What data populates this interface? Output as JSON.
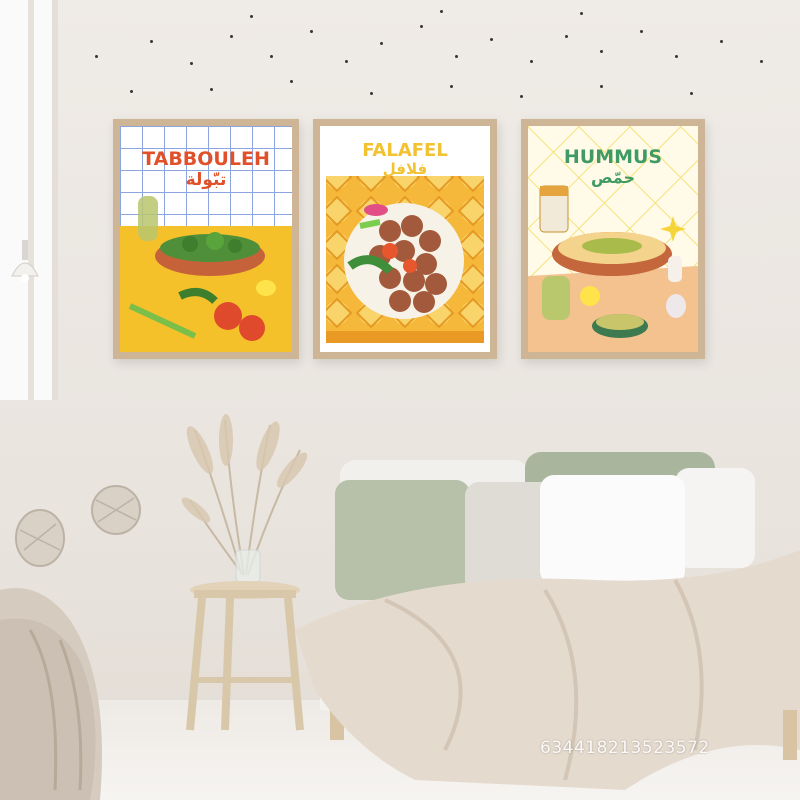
{
  "posters": [
    {
      "title": "TABBOULEH",
      "arabic": "تبّولة"
    },
    {
      "title": "FALAFEL",
      "arabic": "فلافل"
    },
    {
      "title": "HUMMUS",
      "arabic": "حمّص"
    }
  ],
  "watermark": "634418213523572",
  "colors": {
    "tabbouleh_title": "#e2502a",
    "falafel_title": "#f2c230",
    "hummus_title": "#3f9a63",
    "frame": "#cdb596",
    "wall": "#ece7e1"
  },
  "objects": [
    "wall-dots",
    "pampas-grass-vase",
    "side-stool",
    "bed",
    "pillows",
    "throw-blanket",
    "woven-baskets",
    "wall-lamp"
  ]
}
